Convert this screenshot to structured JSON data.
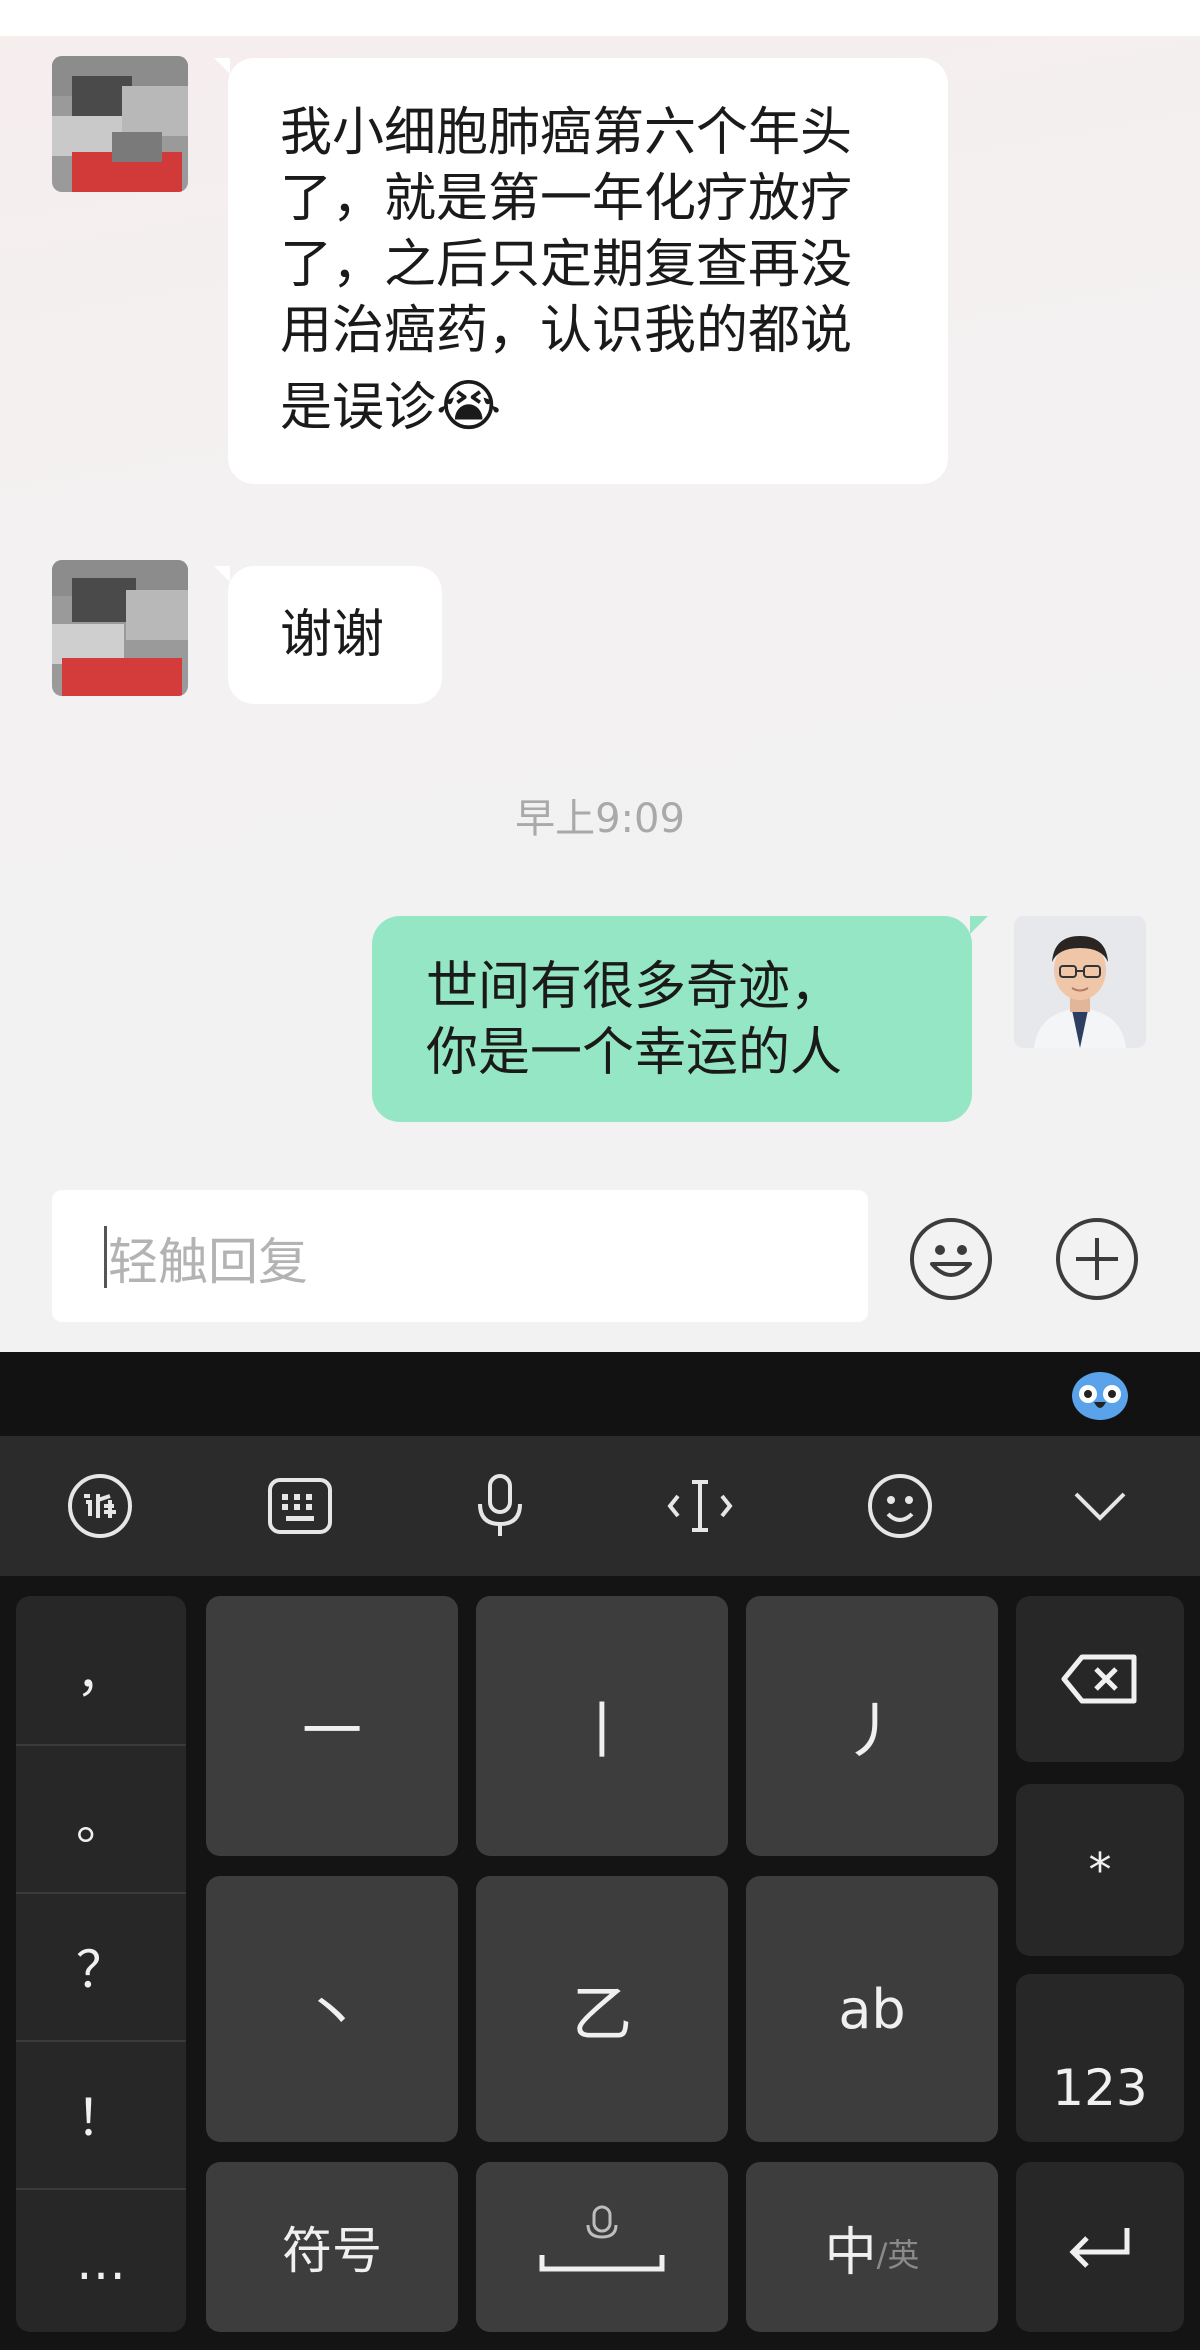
{
  "messages": [
    {
      "side": "left",
      "lines": [
        "我小细胞肺癌第六个年头",
        "了，就是第一年化疗放疗",
        "了，之后只定期复查再没",
        "用治癌药，认识我的都说",
        "是误诊"
      ],
      "emoji": "😭"
    },
    {
      "side": "left",
      "lines": [
        "谢谢"
      ]
    },
    {
      "side": "right",
      "lines": [
        "世间有很多奇迹，",
        "你是一个幸运的人"
      ]
    }
  ],
  "timestamp": "早上9:09",
  "input": {
    "placeholder": "轻触回复"
  },
  "keyboard": {
    "punctuation": [
      "，",
      "。",
      "？",
      "！",
      "…"
    ],
    "keys": {
      "k1": "一",
      "k2": "丨",
      "k3": "丿",
      "k4": "丶",
      "k5": "乙",
      "k6": "ab",
      "k7": "符号",
      "k8": "",
      "k9_main": "中",
      "k9_sub": "/英",
      "star": "*",
      "num": "123"
    }
  },
  "colors": {
    "accent": "#95e6c5",
    "kb_key": "#3d3d3d",
    "kb_bg": "#141414"
  }
}
